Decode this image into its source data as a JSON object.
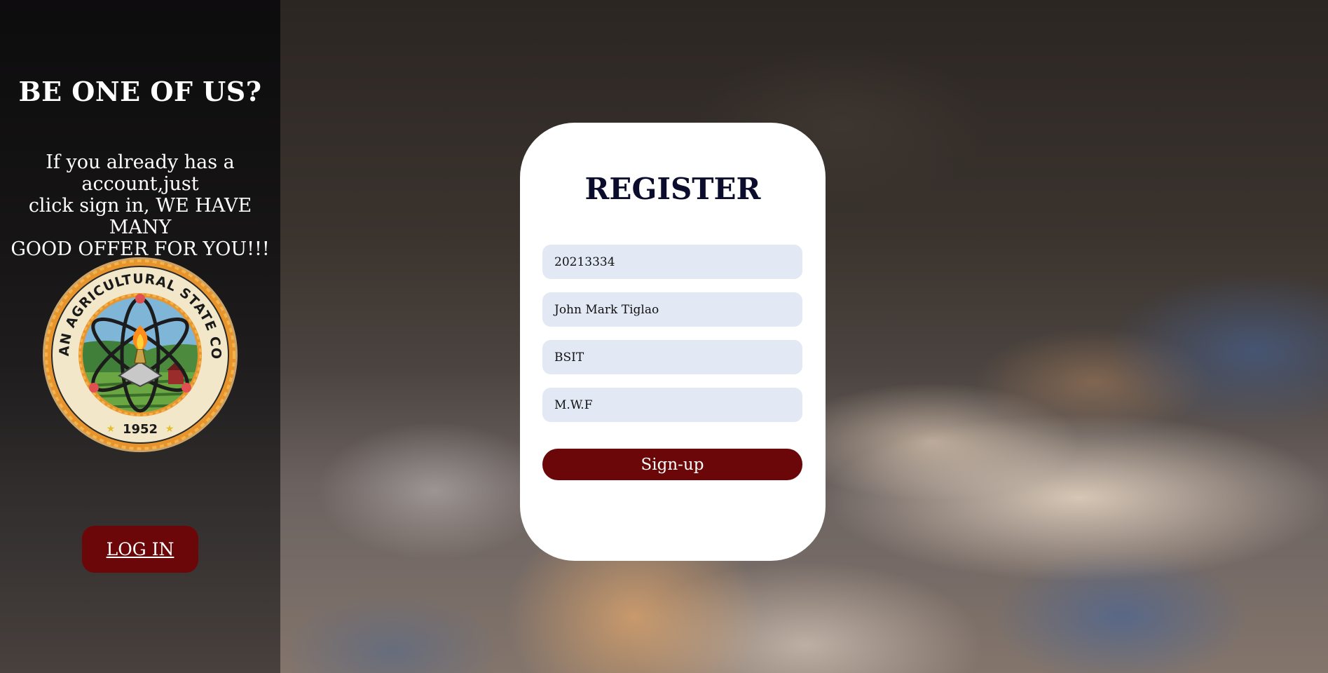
{
  "sidebar": {
    "title": "BE ONE OF US?",
    "line1": "If you already has a account,just",
    "line2": "click sign in, WE HAVE MANY",
    "line3": "GOOD OFFER FOR YOU!!!",
    "logo": {
      "icon": "college-seal-icon",
      "ring_text": "BULACAN AGRICULTURAL STATE COLLEGE",
      "year": "1952",
      "ring_color": "#e8942c"
    },
    "login_label": "LOG IN"
  },
  "form": {
    "title": "REGISTER",
    "fields": [
      {
        "value": "20213334"
      },
      {
        "value": "John Mark Tiglao"
      },
      {
        "value": "BSIT"
      },
      {
        "value": "M.W.F"
      }
    ],
    "signup_label": "Sign-up"
  },
  "colors": {
    "accent": "#6b0708",
    "field_bg": "#e2e8f4",
    "card_bg": "#ffffff",
    "title_color": "#0c0c2c"
  }
}
